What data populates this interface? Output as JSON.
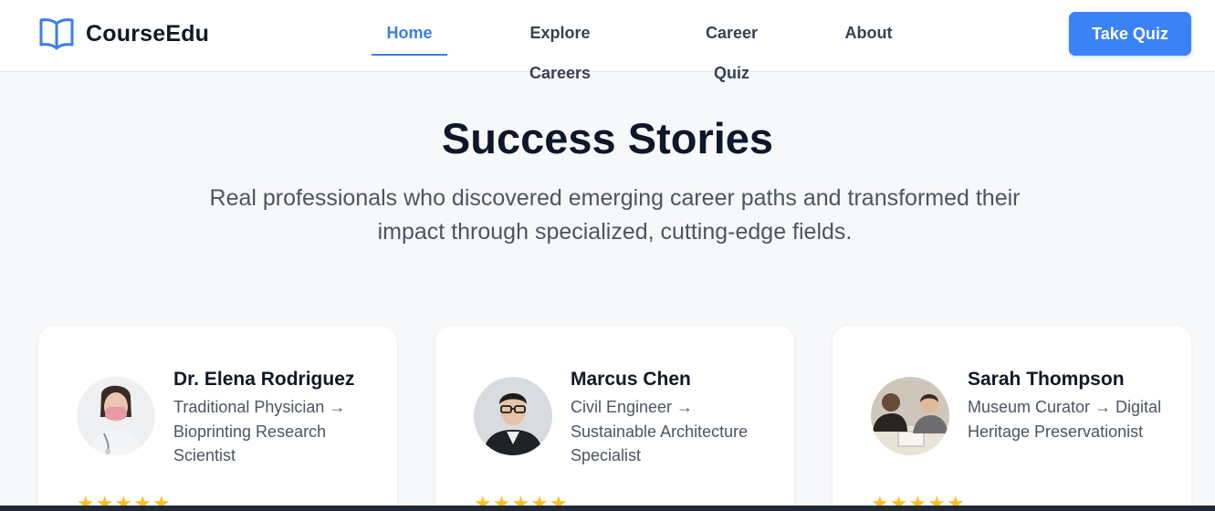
{
  "brand": {
    "name": "CourseEdu",
    "icon": "open-book-icon"
  },
  "nav": {
    "items": [
      {
        "label": "Home",
        "active": true
      },
      {
        "label": "Explore Careers",
        "active": false
      },
      {
        "label": "Career Quiz",
        "active": false
      },
      {
        "label": "About",
        "active": false
      }
    ],
    "cta_label": "Take Quiz"
  },
  "hero": {
    "title": "Success Stories",
    "subtitle": "Real professionals who discovered emerging career paths and transformed their impact through specialized, cutting-edge fields."
  },
  "stories": [
    {
      "name": "Dr. Elena Rodriguez",
      "role": "Traditional Physician → Bioprinting Research Scientist",
      "rating": 5
    },
    {
      "name": "Marcus Chen",
      "role": "Civil Engineer → Sustainable Architecture Specialist",
      "rating": 5
    },
    {
      "name": "Sarah Thompson",
      "role": "Museum Curator → Digital Heritage Preservationist",
      "rating": 5
    }
  ],
  "colors": {
    "accent": "#3b82f6",
    "star": "#fbbf24",
    "background": "#f7f8fa"
  }
}
